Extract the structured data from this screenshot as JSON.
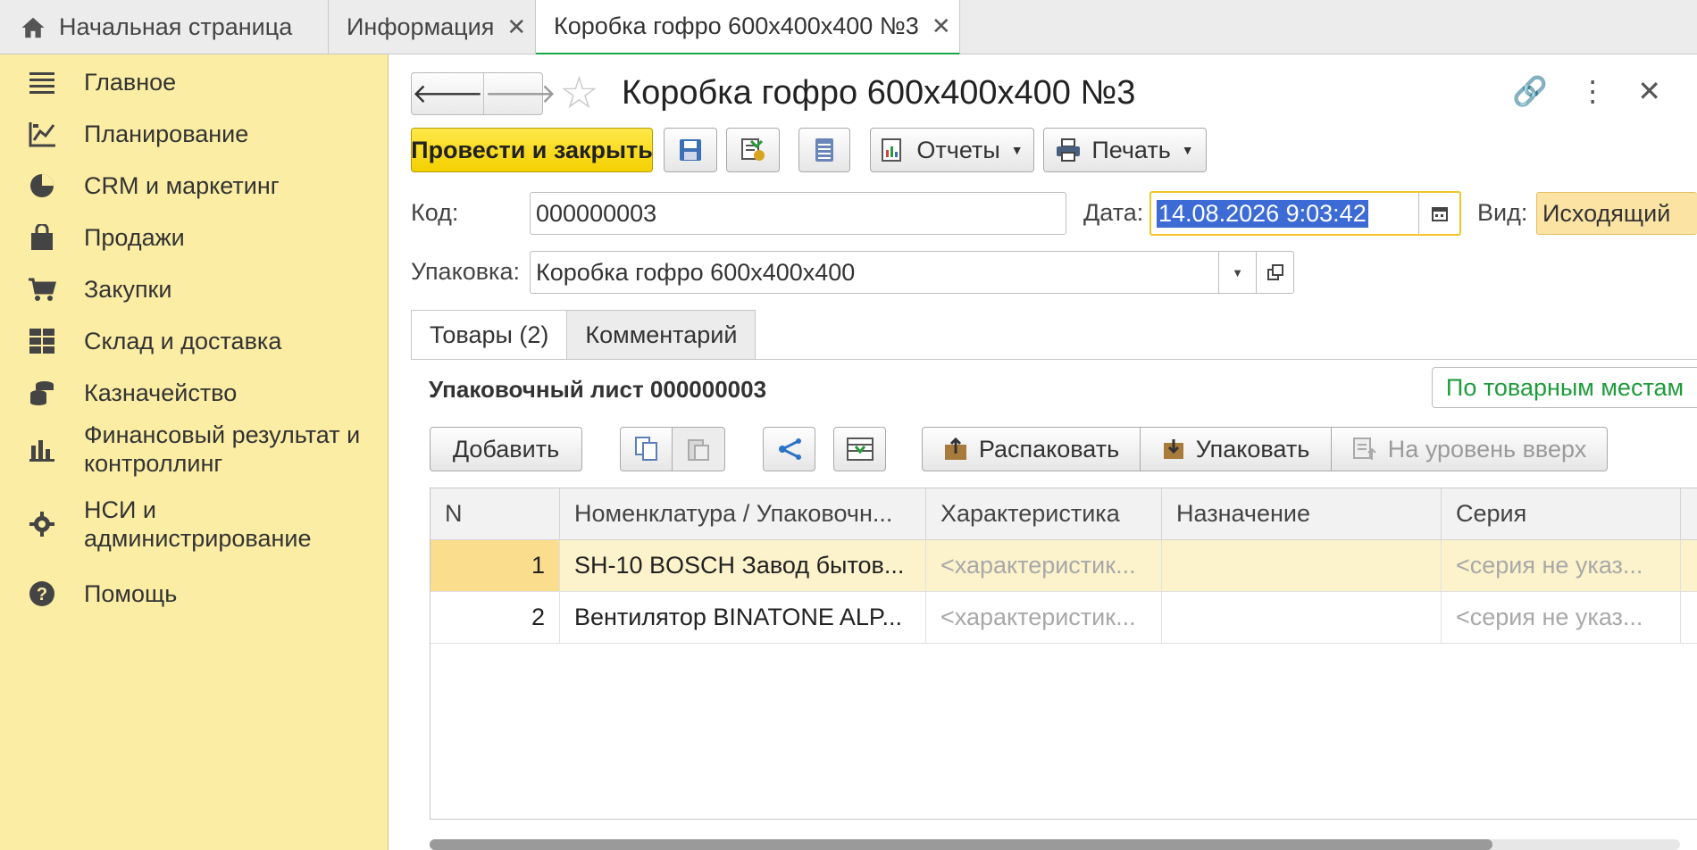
{
  "tabs": [
    {
      "label": "Начальная страница"
    },
    {
      "label": "Информация"
    },
    {
      "label": "Коробка гофро 600х400х400 №3"
    }
  ],
  "sidebar": {
    "items": [
      {
        "label": "Главное",
        "icon": "menu-icon"
      },
      {
        "label": "Планирование",
        "icon": "planning-icon"
      },
      {
        "label": "CRM и маркетинг",
        "icon": "pie-chart-icon"
      },
      {
        "label": "Продажи",
        "icon": "shopping-bag-icon"
      },
      {
        "label": "Закупки",
        "icon": "cart-icon"
      },
      {
        "label": "Склад и доставка",
        "icon": "warehouse-grid-icon"
      },
      {
        "label": "Казначейство",
        "icon": "coins-icon"
      },
      {
        "label": "Финансовый результат и контроллинг",
        "icon": "bar-chart-icon"
      },
      {
        "label": "НСИ и администрирование",
        "icon": "gear-icon"
      },
      {
        "label": "Помощь",
        "icon": "help-icon"
      }
    ]
  },
  "document": {
    "title": "Коробка гофро 600х400х400 №3"
  },
  "toolbar": {
    "post_close": "Провести и закрыть",
    "reports": "Отчеты",
    "print": "Печать"
  },
  "form": {
    "code_label": "Код:",
    "code_value": "000000003",
    "date_label": "Дата:",
    "date_value": "14.08.2026  9:03:42",
    "kind_label": "Вид:",
    "kind_value": "Исходящий",
    "package_label": "Упаковка:",
    "package_value": "Коробка гофро 600х400х400"
  },
  "subtabs": [
    {
      "label": "Товары (2)"
    },
    {
      "label": "Комментарий"
    }
  ],
  "packing": {
    "title": "Упаковочный лист 000000003",
    "by_places": "По товарным местам",
    "add": "Добавить",
    "unpack": "Распаковать",
    "pack": "Упаковать",
    "level_up": "На уровень вверх"
  },
  "table": {
    "columns": [
      "N",
      "Номенклатура / Упаковочн...",
      "Характеристика",
      "Назначение",
      "Серия"
    ],
    "rows": [
      {
        "n": "1",
        "nomenclature": "SH-10 BOSCH Завод бытов...",
        "characteristic": "<характеристик...",
        "purpose": "",
        "series": "<серия не указ..."
      },
      {
        "n": "2",
        "nomenclature": "Вентилятор BINATONE ALP...",
        "characteristic": "<характеристик...",
        "purpose": "",
        "series": "<серия не указ..."
      }
    ]
  },
  "colors": {
    "sidebar_bg": "#fbeda4",
    "accent_green": "#18a64c",
    "primary_button": "#f4d000",
    "selection": "#3d6bd6"
  }
}
